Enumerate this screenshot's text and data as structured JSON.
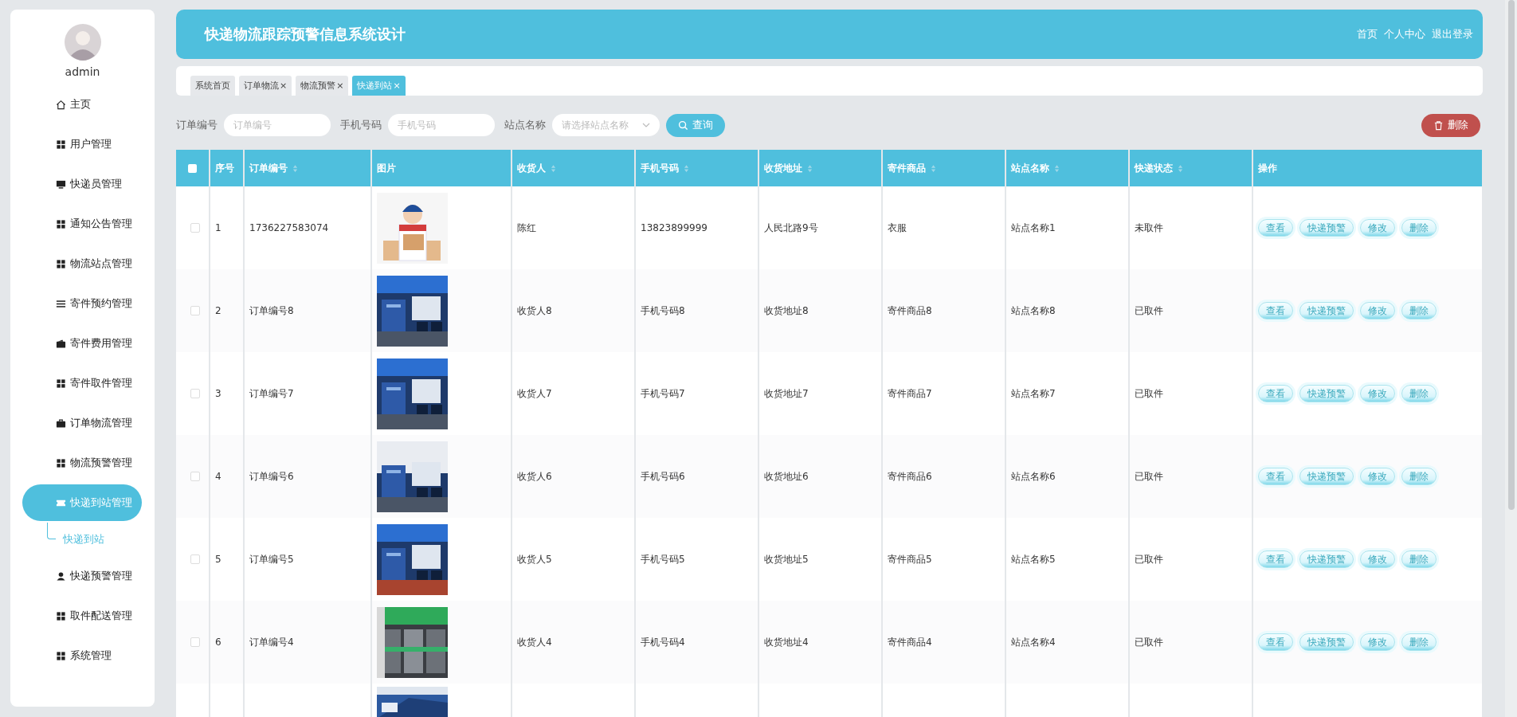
{
  "sidebar": {
    "user": "admin",
    "items": [
      {
        "label": "主页",
        "selected": false
      },
      {
        "label": "用户管理",
        "selected": false
      },
      {
        "label": "快递员管理",
        "selected": false
      },
      {
        "label": "通知公告管理",
        "selected": false
      },
      {
        "label": "物流站点管理",
        "selected": false
      },
      {
        "label": "寄件预约管理",
        "selected": false
      },
      {
        "label": "寄件费用管理",
        "selected": false
      },
      {
        "label": "寄件取件管理",
        "selected": false
      },
      {
        "label": "订单物流管理",
        "selected": false
      },
      {
        "label": "物流预警管理",
        "selected": false
      },
      {
        "label": "快递到站管理",
        "selected": true,
        "children": [
          {
            "label": "快递到站"
          }
        ]
      },
      {
        "label": "快递预警管理",
        "selected": false
      },
      {
        "label": "取件配送管理",
        "selected": false
      },
      {
        "label": "系统管理",
        "selected": false
      }
    ]
  },
  "header": {
    "title": "快递物流跟踪预警信息系统设计",
    "links": [
      "首页",
      "个人中心",
      "退出登录"
    ]
  },
  "tabs": [
    {
      "label": "系统首页",
      "selected": false
    },
    {
      "label": "订单物流",
      "close": "×",
      "selected": false
    },
    {
      "label": "物流预警",
      "close": "×",
      "selected": false
    },
    {
      "label": "快递到站",
      "close": "×",
      "selected": true
    }
  ],
  "search": {
    "fields": [
      {
        "label": "订单编号",
        "placeholder": "订单编号",
        "kind": "text"
      },
      {
        "label": "手机号码",
        "placeholder": "手机号码",
        "kind": "text"
      },
      {
        "label": "站点名称",
        "placeholder": "请选择站点名称",
        "kind": "select"
      }
    ],
    "query_button": "查询",
    "delete_button": "删除"
  },
  "table": {
    "select_all": {
      "checked": false
    },
    "columns": [
      {
        "label": "序号",
        "sortable": false
      },
      {
        "label": "订单编号",
        "sortable": true
      },
      {
        "label": "图片",
        "sortable": false
      },
      {
        "label": "收货人",
        "sortable": true
      },
      {
        "label": "手机号码",
        "sortable": true
      },
      {
        "label": "收货地址",
        "sortable": true
      },
      {
        "label": "寄件商品",
        "sortable": true
      },
      {
        "label": "站点名称",
        "sortable": true
      },
      {
        "label": "快递状态",
        "sortable": true
      },
      {
        "label": "操作",
        "sortable": false
      }
    ],
    "rows": [
      {
        "checked": false,
        "index": "1",
        "order_no": "1736227583074",
        "receiver": "陈红",
        "phone": "13823899999",
        "address": "人民北路9号",
        "goods": "衣服",
        "station": "站点名称1",
        "status": "未取件",
        "actions": [
          "查看",
          "快递预警",
          "修改",
          "删除"
        ]
      },
      {
        "checked": false,
        "index": "2",
        "order_no": "订单编号8",
        "receiver": "收货人8",
        "phone": "手机号码8",
        "address": "收货地址8",
        "goods": "寄件商品8",
        "station": "站点名称8",
        "status": "已取件",
        "actions": [
          "查看",
          "快递预警",
          "修改",
          "删除"
        ]
      },
      {
        "checked": false,
        "index": "3",
        "order_no": "订单编号7",
        "receiver": "收货人7",
        "phone": "手机号码7",
        "address": "收货地址7",
        "goods": "寄件商品7",
        "station": "站点名称7",
        "status": "已取件",
        "actions": [
          "查看",
          "快递预警",
          "修改",
          "删除"
        ]
      },
      {
        "checked": false,
        "index": "4",
        "order_no": "订单编号6",
        "receiver": "收货人6",
        "phone": "手机号码6",
        "address": "收货地址6",
        "goods": "寄件商品6",
        "station": "站点名称6",
        "status": "已取件",
        "actions": [
          "查看",
          "快递预警",
          "修改",
          "删除"
        ]
      },
      {
        "checked": false,
        "index": "5",
        "order_no": "订单编号5",
        "receiver": "收货人5",
        "phone": "手机号码5",
        "address": "收货地址5",
        "goods": "寄件商品5",
        "station": "站点名称5",
        "status": "已取件",
        "actions": [
          "查看",
          "快递预警",
          "修改",
          "删除"
        ]
      },
      {
        "checked": false,
        "index": "6",
        "order_no": "订单编号4",
        "receiver": "收货人4",
        "phone": "手机号码4",
        "address": "收货地址4",
        "goods": "寄件商品4",
        "station": "站点名称4",
        "status": "已取件",
        "actions": [
          "查看",
          "快递预警",
          "修改",
          "删除"
        ]
      }
    ]
  }
}
